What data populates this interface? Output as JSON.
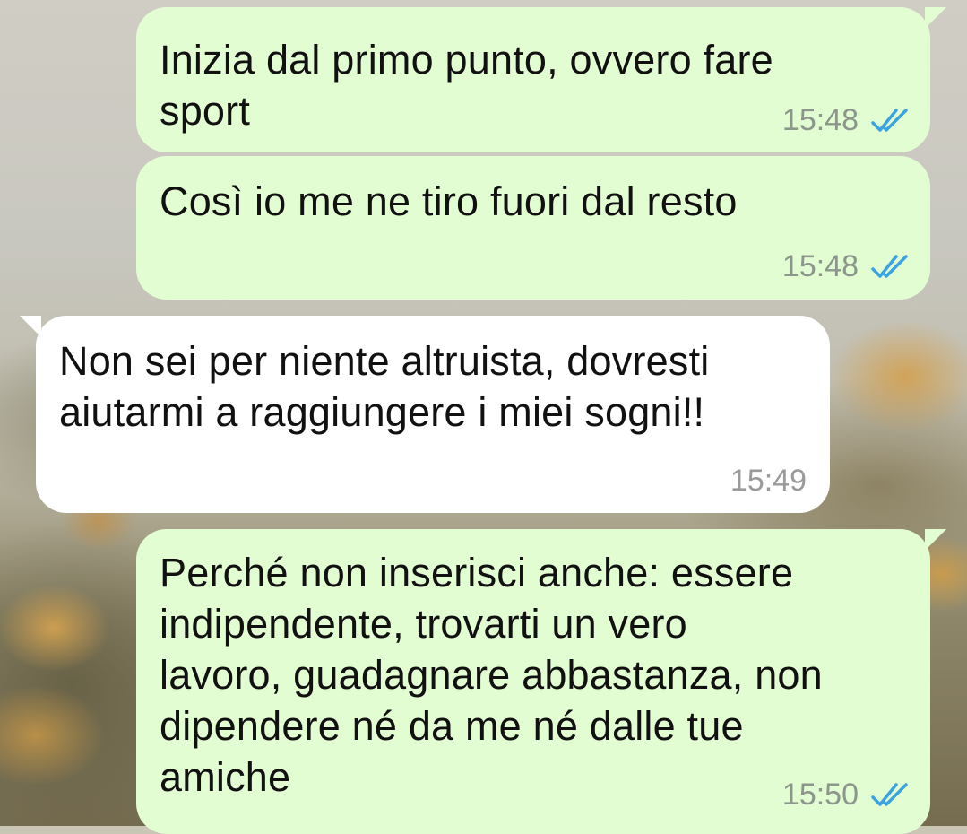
{
  "chat": {
    "colors": {
      "outgoing_bubble": "#e2fdd2",
      "incoming_bubble": "#ffffff",
      "read_ticks": "#3aa3e0",
      "timestamp": "#8c968b"
    },
    "messages": [
      {
        "direction": "outgoing",
        "text": "Inizia dal primo punto, ovvero fare\nsport",
        "time": "15:48",
        "status": "read",
        "status_icon": "double-check-icon"
      },
      {
        "direction": "outgoing",
        "text": "Così io me ne tiro fuori dal resto",
        "time": "15:48",
        "status": "read",
        "status_icon": "double-check-icon"
      },
      {
        "direction": "incoming",
        "text": "Non sei per niente altruista, dovresti\naiutarmi a raggiungere i miei sogni!!",
        "time": "15:49"
      },
      {
        "direction": "outgoing",
        "text": "Perché non inserisci anche: essere\nindipendente, trovarti un vero\nlavoro, guadagnare abbastanza, non\ndipendere né da me né dalle tue\namiche",
        "time": "15:50",
        "status": "read",
        "status_icon": "double-check-icon"
      }
    ]
  }
}
